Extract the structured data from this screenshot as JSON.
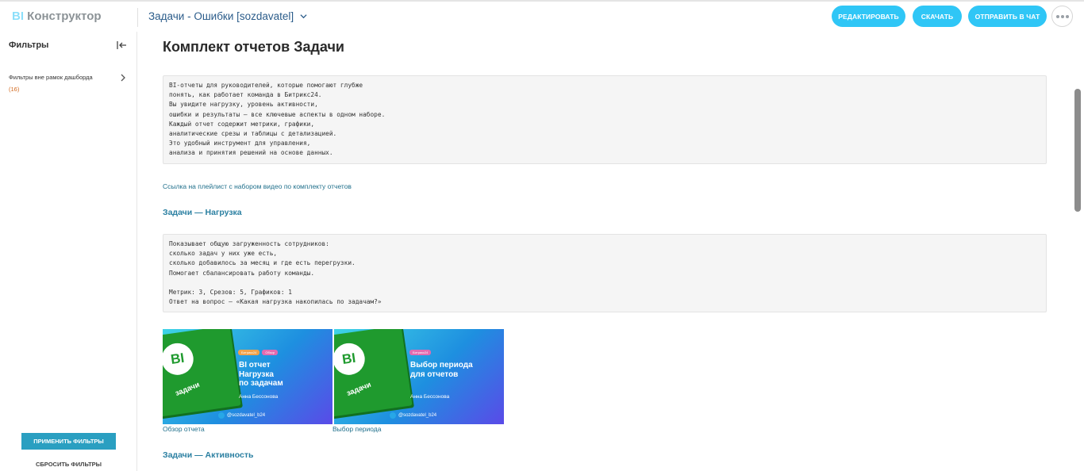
{
  "header": {
    "logo_bi": "BI",
    "logo_text": "Конструктор",
    "dashboard_title": "Задачи - Ошибки [sozdavatel]",
    "edit_label": "РЕДАКТИРОВАТЬ",
    "download_label": "СКАЧАТЬ",
    "send_label": "ОТПРАВИТЬ В ЧАТ"
  },
  "sidebar": {
    "title": "Фильтры",
    "item_label": "Фильтры вне рамок дашборда",
    "item_count": "(16)",
    "apply_label": "ПРИМЕНИТЬ ФИЛЬТРЫ",
    "reset_label": "СБРОСИТЬ ФИЛЬТРЫ"
  },
  "main": {
    "title": "Комплект отчетов Задачи",
    "intro": "BI-отчеты для руководителей, которые помогают глубже\nпонять, как работает команда в Битрикс24.\nВы увидите нагрузку, уровень активности,\nошибки и результаты — все ключевые аспекты в одном наборе.\nКаждый отчет содержит метрики, графики,\nаналитические срезы и таблицы с детализацией.\nЭто удобный инструмент для управления,\nанализа и принятия решений на основе данных.",
    "playlist_link": "Ссылка на плейлист с набором видео по комплекту отчетов",
    "section1_title": "Задачи — Нагрузка",
    "section1_text": "Показывает общую загруженность сотрудников:\nсколько задач у них уже есть,\nсколько добавилось за месяц и где есть перегрузки.\nПомогает сбалансировать работу команды.\n\nМетрик: 3, Срезов: 5, Графиков: 1\nОтвет на вопрос – «Какая нагрузка накопилась по задачам?»",
    "section2_title": "Задачи — Активность",
    "thumbs": [
      {
        "badge": "BI",
        "label": "задачи",
        "tag1": "Битрикс24",
        "tag2": "Обзор",
        "heading": "BI отчет\nНагрузка\nпо задачам",
        "author": "Анна Бессонова",
        "telegram": "@sozdavatel_b24",
        "caption": "Обзор отчета"
      },
      {
        "badge": "BI",
        "label": "задачи",
        "tag1": "Битрикс24",
        "tag2": "",
        "heading": "Выбор периода\nдля отчетов",
        "author": "Анна Бессонова",
        "telegram": "@sozdavatel_b24",
        "caption": "Выбор периода"
      }
    ]
  },
  "colors": {
    "accent": "#2fc6f6",
    "apply_button": "#2a9fc1",
    "link": "#1f6f8b",
    "section_heading": "#2a7fa1"
  }
}
